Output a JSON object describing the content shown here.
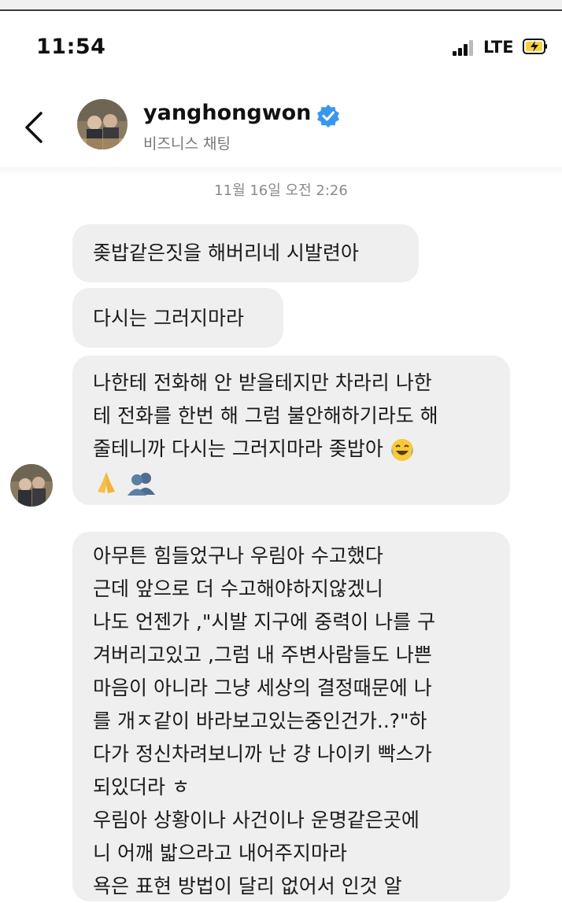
{
  "status_bar": {
    "time": "11:54",
    "network": "LTE",
    "icons": [
      "signal-bars-icon",
      "battery-charging-icon"
    ]
  },
  "header": {
    "username": "yanghongwon",
    "subtitle": "비즈니스 채팅",
    "verified": true,
    "icons": [
      "back-chevron-icon",
      "verified-badge-icon"
    ]
  },
  "conversation": {
    "timestamp": "11월 16일 오전 2:26",
    "messages": [
      {
        "lines": [
          "좆밥같은짓을 해버리네 시발련아"
        ]
      },
      {
        "lines": [
          "다시는 그러지마라"
        ]
      },
      {
        "lines": [
          "나한테 전화해 안 받을테지만 차라리 나한",
          "테 전화를 한번 해 그럼 불안해하기라도 해",
          "줄테니까 다시는 그러지마라 좆밥아"
        ],
        "emojis": [
          "face-with-tears-of-joy-emoji",
          "folded-hands-emoji",
          "busts-in-silhouette-emoji"
        ]
      },
      {
        "lines": [
          "아무튼 힘들었구나 우림아 수고했다",
          "근데 앞으로 더 수고해야하지않겠니",
          "나도 언젠가 ,\"시발 지구에 중력이 나를 구",
          "겨버리고있고 ,그럼 내 주변사람들도 나쁜",
          "마음이 아니라 그냥 세상의 결정때문에 나",
          "를 개ㅈ같이 바라보고있는중인건가..?\"하",
          "다가 정신차려보니까 난 걍 나이키 빡스가",
          "되있더라 ㅎ",
          "우림아 상황이나 사건이나 운명같은곳에",
          "니 어깨 밟으라고 내어주지마라",
          "욕은 표현 방법이 달리 없어서 인것 알"
        ]
      }
    ]
  },
  "colors": {
    "bubble": "#efefef",
    "verified": "#3897f0",
    "text": "#1a1a1a",
    "muted": "#8a8a8a"
  }
}
